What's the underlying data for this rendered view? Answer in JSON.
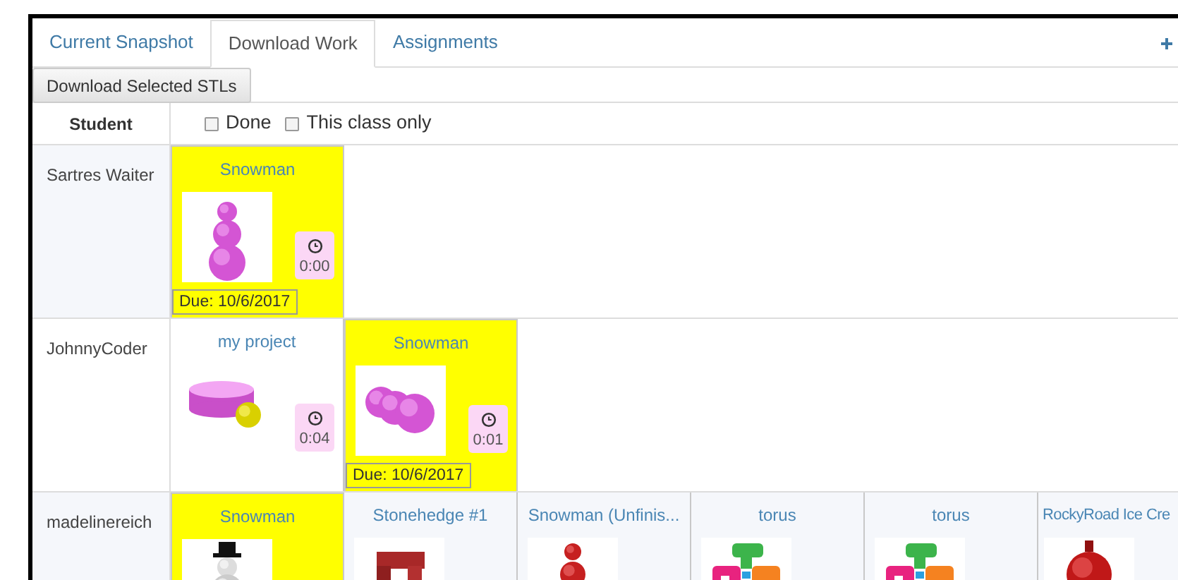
{
  "tabs": [
    {
      "label": "Current Snapshot",
      "selected": false
    },
    {
      "label": "Download Work",
      "selected": true
    },
    {
      "label": "Assignments",
      "selected": false
    }
  ],
  "toolbar": {
    "button": "Download Selected STLs"
  },
  "table": {
    "student_header": "Student",
    "filters": [
      {
        "label": "Done",
        "checked": false
      },
      {
        "label": "This class only",
        "checked": false
      }
    ],
    "rows": [
      {
        "student": "Sartres Waiter",
        "cells": [
          {
            "title": "Snowman",
            "assigned": true,
            "kind": "stack",
            "time": "0:00",
            "due": "Due: 10/6/2017"
          }
        ]
      },
      {
        "student": "JohnnyCoder",
        "cells": [
          {
            "title": "my project",
            "assigned": false,
            "kind": "disc",
            "time": "0:04"
          },
          {
            "title": "Snowman",
            "assigned": true,
            "kind": "row",
            "time": "0:01",
            "due": "Due: 10/6/2017"
          }
        ]
      },
      {
        "student": "madelinereich",
        "cells": [
          {
            "title": "Snowman",
            "assigned": true,
            "kind": "hat"
          },
          {
            "title": "Stonehedge #1",
            "assigned": false,
            "kind": "stones"
          },
          {
            "title": "Snowman (Unfinis...",
            "assigned": false,
            "kind": "red"
          },
          {
            "title": "torus",
            "assigned": false,
            "kind": "blocks"
          },
          {
            "title": "torus",
            "assigned": false,
            "kind": "blocks"
          },
          {
            "title": "RockyRoad Ice Cre",
            "assigned": false,
            "kind": "ornament"
          }
        ]
      }
    ]
  }
}
